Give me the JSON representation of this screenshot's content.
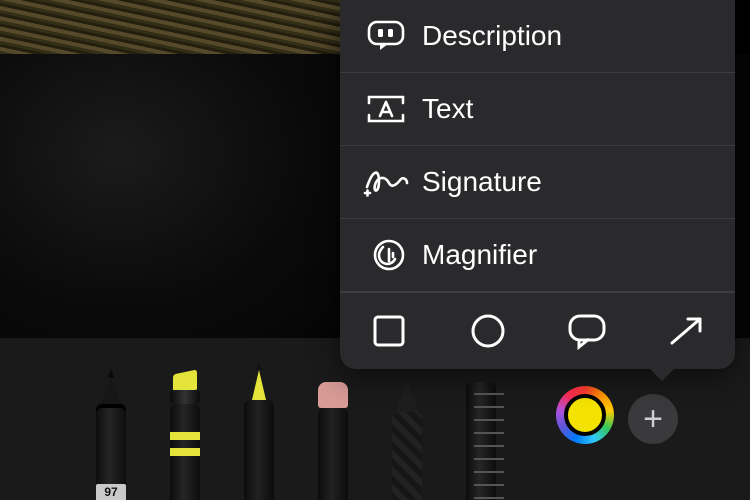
{
  "popover": {
    "items": [
      {
        "label": "Description"
      },
      {
        "label": "Text"
      },
      {
        "label": "Signature"
      },
      {
        "label": "Magnifier"
      }
    ]
  },
  "tool_size_badge": "97",
  "current_color": "#f4e300"
}
